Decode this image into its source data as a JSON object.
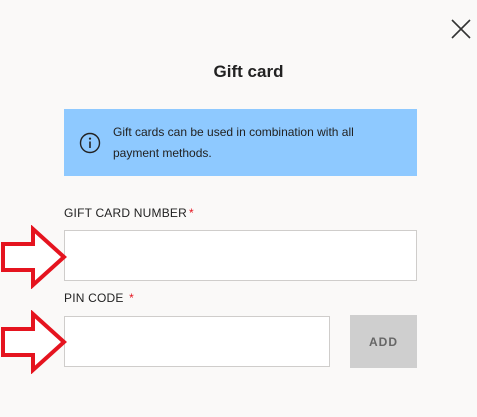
{
  "modal": {
    "title": "Gift card",
    "close_icon": "close-icon"
  },
  "info": {
    "icon": "info-icon",
    "text": "Gift cards can be used in combination with all payment methods.",
    "background_color": "#8ec9ff"
  },
  "form": {
    "gift_card_number": {
      "label": "GIFT CARD NUMBER",
      "required_mark": "*",
      "value": ""
    },
    "pin_code": {
      "label": "PIN CODE",
      "required_mark": "*",
      "value": ""
    },
    "add_button_label": "ADD"
  },
  "annotations": {
    "arrow_icon": "right-arrow-icon",
    "arrow_color": "#e5141f"
  }
}
